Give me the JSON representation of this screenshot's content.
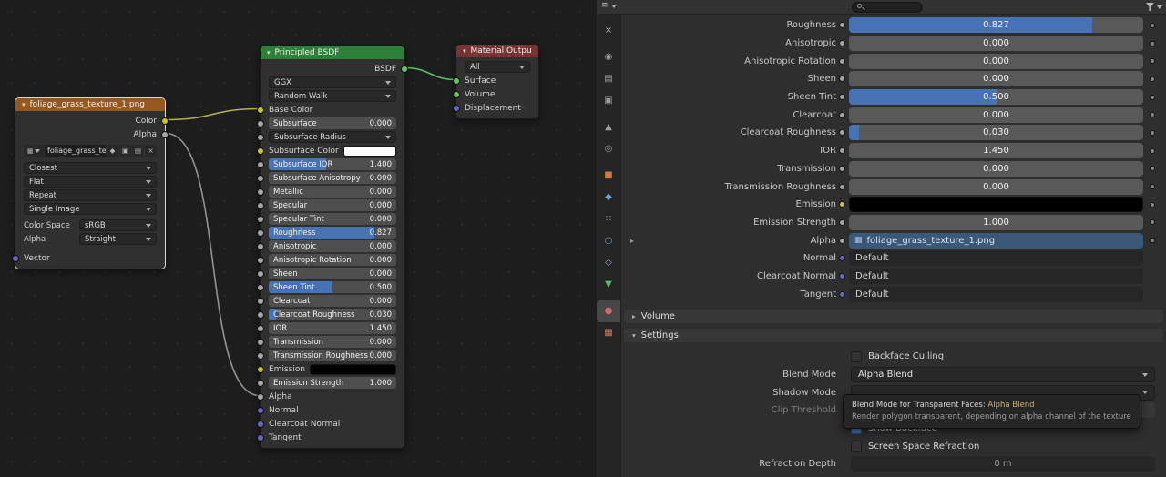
{
  "colors": {
    "accent": "#4772b3",
    "header_shader": "#2d8038",
    "header_texture": "#96591d",
    "header_output": "#763434",
    "sock_yellow": "#c7c729",
    "sock_green": "#63c763",
    "sock_purple": "#6666c7",
    "sock_gray": "#a5a5a5",
    "link_bg": "#3b5878",
    "wire_yellow": "#bcbc51",
    "wire_gray": "#9a9a9a",
    "wire_green": "#63c763"
  },
  "node_editor": {
    "image_node": {
      "title": "foliage_grass_texture_1.png",
      "color_output": "Color",
      "alpha_output": "Alpha",
      "datablock": "foliage_grass_text...",
      "interpolation": "Closest",
      "projection": "Flat",
      "extension": "Repeat",
      "source": "Single Image",
      "color_space_label": "Color Space",
      "color_space": "sRGB",
      "alpha_label": "Alpha",
      "alpha_mode": "Straight",
      "vector_input": "Vector"
    },
    "bsdf_node": {
      "title": "Principled BSDF",
      "rows": [
        {
          "t": "out",
          "label": "BSDF",
          "sr": "green"
        },
        {
          "t": "select",
          "v": "GGX"
        },
        {
          "t": "select",
          "v": "Random Walk"
        },
        {
          "t": "in",
          "label": "Base Color",
          "sl": "yellow"
        },
        {
          "t": "slider",
          "label": "Subsurface",
          "value": "0.000",
          "fill": 0,
          "sl": "gray"
        },
        {
          "t": "select",
          "v": "Subsurface Radius",
          "sl": "gray"
        },
        {
          "t": "color",
          "label": "Subsurface Color",
          "color": "#ffffff",
          "sl": "yellow"
        },
        {
          "t": "slider",
          "label": "Subsurface IOR",
          "value": "1.400",
          "fill": 0.45,
          "sl": "gray"
        },
        {
          "t": "slider",
          "label": "Subsurface Anisotropy",
          "value": "0.000",
          "fill": 0,
          "sl": "gray"
        },
        {
          "t": "slider",
          "label": "Metallic",
          "value": "0.000",
          "fill": 0,
          "sl": "gray"
        },
        {
          "t": "slider",
          "label": "Specular",
          "value": "0.000",
          "fill": 0,
          "sl": "gray"
        },
        {
          "t": "slider",
          "label": "Specular Tint",
          "value": "0.000",
          "fill": 0,
          "sl": "gray"
        },
        {
          "t": "slider",
          "label": "Roughness",
          "value": "0.827",
          "fill": 0.827,
          "sl": "gray"
        },
        {
          "t": "slider",
          "label": "Anisotropic",
          "value": "0.000",
          "fill": 0,
          "sl": "gray"
        },
        {
          "t": "slider",
          "label": "Anisotropic Rotation",
          "value": "0.000",
          "fill": 0,
          "sl": "gray"
        },
        {
          "t": "slider",
          "label": "Sheen",
          "value": "0.000",
          "fill": 0,
          "sl": "gray"
        },
        {
          "t": "slider",
          "label": "Sheen Tint",
          "value": "0.500",
          "fill": 0.5,
          "sl": "gray"
        },
        {
          "t": "slider",
          "label": "Clearcoat",
          "value": "0.000",
          "fill": 0,
          "sl": "gray"
        },
        {
          "t": "slider",
          "label": "Clearcoat Roughness",
          "value": "0.030",
          "fill": 0.06,
          "sl": "gray"
        },
        {
          "t": "slider",
          "label": "IOR",
          "value": "1.450",
          "fill": 0,
          "sl": "gray"
        },
        {
          "t": "slider",
          "label": "Transmission",
          "value": "0.000",
          "fill": 0,
          "sl": "gray"
        },
        {
          "t": "slider",
          "label": "Transmission Roughness",
          "value": "0.000",
          "fill": 0,
          "sl": "gray"
        },
        {
          "t": "color",
          "label": "Emission",
          "color": "#000000",
          "sl": "yellow"
        },
        {
          "t": "slider",
          "label": "Emission Strength",
          "value": "1.000",
          "fill": 0,
          "sl": "gray"
        },
        {
          "t": "in",
          "label": "Alpha",
          "sl": "gray"
        },
        {
          "t": "in",
          "label": "Normal",
          "sl": "purple"
        },
        {
          "t": "in",
          "label": "Clearcoat Normal",
          "sl": "purple"
        },
        {
          "t": "in",
          "label": "Tangent",
          "sl": "purple"
        }
      ]
    },
    "output_node": {
      "title": "Material Output",
      "target": "All",
      "surface_input": "Surface",
      "volume_input": "Volume",
      "displacement_input": "Displacement"
    }
  },
  "properties": {
    "rows": [
      {
        "label": "Roughness",
        "type": "slider",
        "value": "0.827",
        "fill": 0.827
      },
      {
        "label": "Anisotropic",
        "type": "slider",
        "value": "0.000",
        "fill": 0
      },
      {
        "label": "Anisotropic Rotation",
        "type": "slider",
        "value": "0.000",
        "fill": 0
      },
      {
        "label": "Sheen",
        "type": "slider",
        "value": "0.000",
        "fill": 0
      },
      {
        "label": "Sheen Tint",
        "type": "slider",
        "value": "0.500",
        "fill": 0.5
      },
      {
        "label": "Clearcoat",
        "type": "slider",
        "value": "0.000",
        "fill": 0
      },
      {
        "label": "Clearcoat Roughness",
        "type": "slider",
        "value": "0.030",
        "fill": 0.035
      },
      {
        "label": "IOR",
        "type": "slider",
        "value": "1.450",
        "fill": 0
      },
      {
        "label": "Transmission",
        "type": "slider",
        "value": "0.000",
        "fill": 0
      },
      {
        "label": "Transmission Roughness",
        "type": "slider",
        "value": "0.000",
        "fill": 0
      },
      {
        "label": "Emission",
        "type": "color",
        "color": "#000000",
        "dot": "yellow"
      },
      {
        "label": "Emission Strength",
        "type": "slider",
        "value": "1.000",
        "fill": 0
      },
      {
        "label": "Alpha",
        "type": "link",
        "value": "foliage_grass_texture_1.png",
        "expand": true
      },
      {
        "label": "Normal",
        "type": "default",
        "value": "Default",
        "dot": "purple",
        "nodecor": true
      },
      {
        "label": "Clearcoat Normal",
        "type": "default",
        "value": "Default",
        "dot": "purple",
        "nodecor": true
      },
      {
        "label": "Tangent",
        "type": "default",
        "value": "Default",
        "dot": "purple",
        "nodecor": true
      }
    ],
    "volume_header": "Volume",
    "settings_header": "Settings",
    "settings": {
      "backface_culling": "Backface Culling",
      "blend_mode_label": "Blend Mode",
      "blend_mode_value": "Alpha Blend",
      "shadow_mode_label": "Shadow Mode",
      "clip_threshold_label": "Clip Threshold",
      "show_backface": "Show Backface",
      "screen_space_refraction": "Screen Space Refraction",
      "refraction_depth_label": "Refraction Depth",
      "refraction_depth_value": "0 m"
    },
    "tooltip": {
      "title": "Blend Mode for Transparent Faces:",
      "title_value": "Alpha Blend",
      "body": "Render polygon transparent, depending on alpha channel of the texture"
    }
  },
  "tabs": {
    "groups": [
      [
        {
          "name": "tool",
          "glyph": "×",
          "color": "#b0b0b0"
        }
      ],
      [
        {
          "name": "render",
          "glyph": "◉",
          "color": "#9f9f9f"
        },
        {
          "name": "output",
          "glyph": "▤",
          "color": "#9f9f9f"
        },
        {
          "name": "view-layer",
          "glyph": "▣",
          "color": "#9f9f9f"
        }
      ],
      [
        {
          "name": "scene",
          "glyph": "▲",
          "color": "#9f9f9f"
        },
        {
          "name": "world",
          "glyph": "◎",
          "color": "#9f9f9f"
        }
      ],
      [
        {
          "name": "object",
          "glyph": "■",
          "color": "#cc7a45"
        },
        {
          "name": "modifiers",
          "glyph": "◆",
          "color": "#6f9fd3"
        },
        {
          "name": "particles",
          "glyph": "∷",
          "color": "#6f9fd3"
        },
        {
          "name": "physics",
          "glyph": "○",
          "color": "#6f9fd3"
        },
        {
          "name": "constraints",
          "glyph": "◇",
          "color": "#8fa8c8"
        },
        {
          "name": "object-data",
          "glyph": "▼",
          "color": "#57b96d"
        }
      ],
      [
        {
          "name": "material",
          "glyph": "●",
          "color": "#cf6a6a",
          "active": true
        },
        {
          "name": "texture",
          "glyph": "▦",
          "color": "#cf7a5a"
        }
      ]
    ]
  }
}
